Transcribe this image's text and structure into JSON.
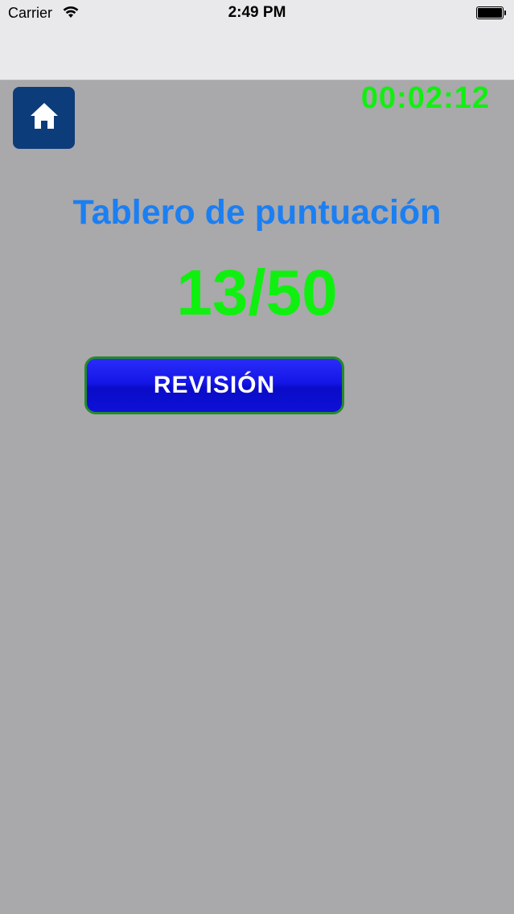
{
  "status_bar": {
    "carrier": "Carrier",
    "time": "2:49 PM",
    "icons": [
      "wifi-icon",
      "battery-icon"
    ]
  },
  "header": {
    "home_icon": "home-icon",
    "timer": "00:02:12"
  },
  "score": {
    "title": "Tablero de puntuación",
    "value": "13/50"
  },
  "review_button": {
    "label": "REVISIÓN"
  },
  "colors": {
    "background": "#a9a8ab",
    "timer": "#10f010",
    "title": "#1b7ff2",
    "score": "#10f010",
    "home_button": "#0d3c7a",
    "review_button": "#1416e8",
    "review_border": "#248a2c"
  }
}
